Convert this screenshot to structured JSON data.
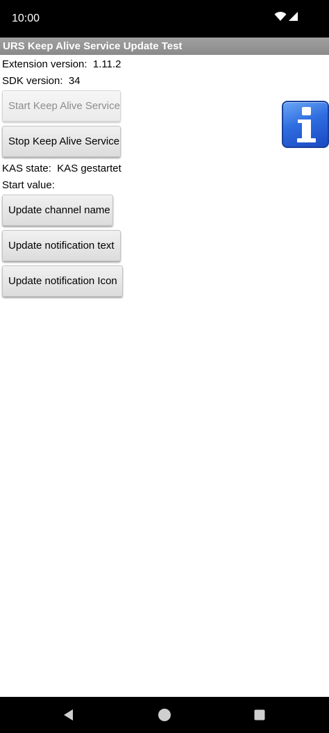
{
  "status_bar": {
    "time": "10:00",
    "icons": [
      "wifi-icon",
      "cellular-signal-icon"
    ]
  },
  "app": {
    "title": "URS Keep Alive Service Update Test"
  },
  "info": {
    "extension_label": "Extension version:",
    "extension_value": "1.11.2",
    "sdk_label": "SDK version:",
    "sdk_value": "34"
  },
  "buttons": {
    "start": "Start Keep Alive Service",
    "stop": "Stop Keep Alive Service",
    "update_channel": "Update channel name",
    "update_text": "Update notification text",
    "update_icon": "Update notification Icon"
  },
  "state": {
    "kas_label": "KAS state:",
    "kas_value": "KAS gestartet",
    "start_value_label": "Start value:",
    "start_value": ""
  },
  "icons": {
    "info": "info-icon"
  },
  "nav_bar": {
    "icons": [
      "back-icon",
      "home-icon",
      "recents-icon"
    ]
  },
  "colors": {
    "title_bar": "#8a8a8a",
    "info_icon_blue": "#2f6de0"
  }
}
